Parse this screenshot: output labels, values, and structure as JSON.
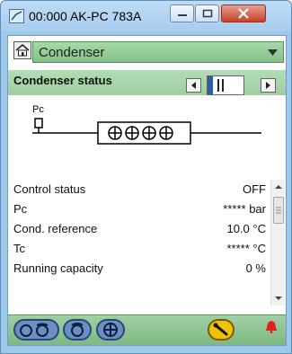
{
  "window": {
    "title": "00:000 AK-PC 783A"
  },
  "selector": {
    "value": "Condenser"
  },
  "section": {
    "title": "Condenser status"
  },
  "diagram": {
    "pc_label": "Pc"
  },
  "status_rows": [
    {
      "label": "Control status",
      "value": "OFF"
    },
    {
      "label": "Pc",
      "value": "***** bar"
    },
    {
      "label": "Cond. reference",
      "value": "10.0 °C"
    },
    {
      "label": "Tc",
      "value": "***** °C"
    },
    {
      "label": "Running capacity",
      "value": "0 %"
    }
  ],
  "colors": {
    "titlebar": "#a7cdee",
    "selector": "#85c288",
    "section": "#9ccf9f",
    "toolbar": "#7db881",
    "alarm": "#e81e1e",
    "wrench": "#f1c200"
  },
  "icons": {
    "app": "gauge-icon",
    "home": "home-icon",
    "minimize": "minimize-icon",
    "maximize": "maximize-icon",
    "close": "close-icon",
    "dropdown": "chevron-down-icon",
    "nav_left": "chevron-left-icon",
    "nav_right": "chevron-right-icon",
    "pressure_sensor": "pressure-sensor-icon",
    "fans": "fan-icon",
    "scroll_up": "scroll-up-icon",
    "scroll_down": "scroll-down-icon",
    "tool_1": "compressor-icon",
    "tool_2": "condenser-icon",
    "tool_3": "fan-icon",
    "wrench": "wrench-icon",
    "alarm": "alarm-bell-icon"
  }
}
